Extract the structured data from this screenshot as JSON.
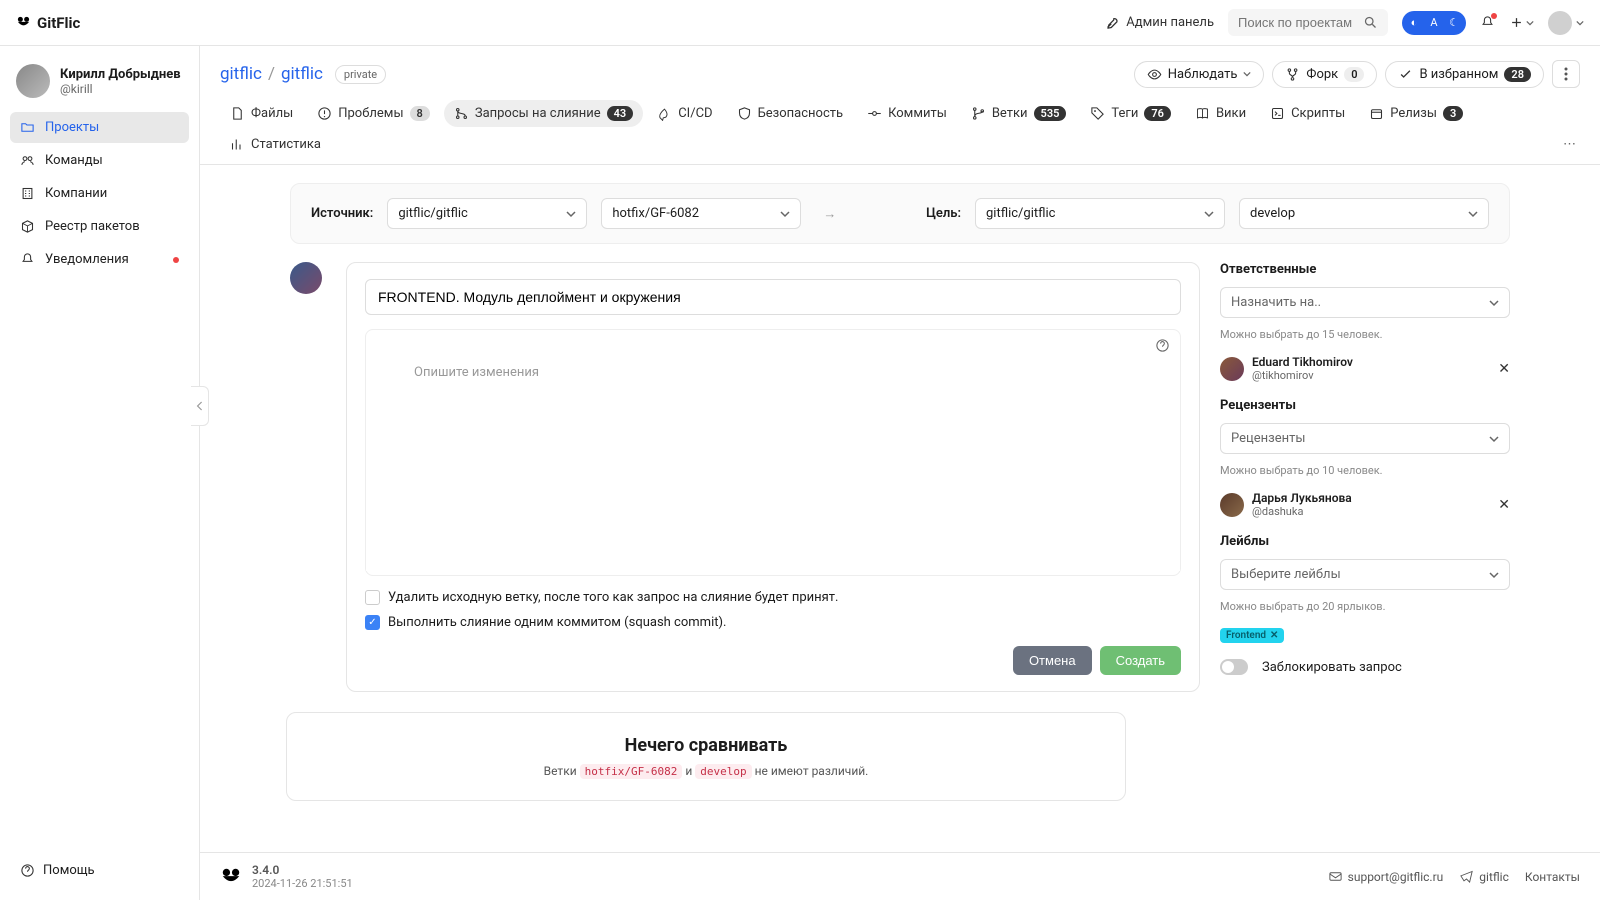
{
  "brand": "GitFlic",
  "topbar": {
    "admin": "Админ панель",
    "search_placeholder": "Поиск по проектам"
  },
  "user": {
    "name": "Кирилл Добрыднев",
    "handle": "@kirill"
  },
  "sidebar": {
    "items": [
      {
        "label": "Проекты"
      },
      {
        "label": "Команды"
      },
      {
        "label": "Компании"
      },
      {
        "label": "Реестр пакетов"
      },
      {
        "label": "Уведомления"
      }
    ],
    "help": "Помощь"
  },
  "repo": {
    "owner": "gitflic",
    "name": "gitflic",
    "visibility": "private",
    "actions": {
      "watch": "Наблюдать",
      "fork": "Форк",
      "fork_count": "0",
      "star": "В избранном",
      "star_count": "28"
    }
  },
  "tabs": [
    {
      "label": "Файлы"
    },
    {
      "label": "Проблемы",
      "count": "8"
    },
    {
      "label": "Запросы на слияние",
      "count": "43"
    },
    {
      "label": "CI/CD"
    },
    {
      "label": "Безопасность"
    },
    {
      "label": "Коммиты"
    },
    {
      "label": "Ветки",
      "count": "535"
    },
    {
      "label": "Теги",
      "count": "76"
    },
    {
      "label": "Вики"
    },
    {
      "label": "Скрипты"
    },
    {
      "label": "Релизы",
      "count": "3"
    },
    {
      "label": "Статистика"
    }
  ],
  "compare": {
    "source_label": "Источник:",
    "source_repo": "gitflic/gitflic",
    "source_branch": "hotfix/GF-6082",
    "target_label": "Цель:",
    "target_repo": "gitflic/gitflic",
    "target_branch": "develop"
  },
  "mr": {
    "title": "FRONTEND. Модуль деплоймент и окружения",
    "desc_placeholder": "Опишите изменения",
    "check_delete": "Удалить исходную ветку, после того как запрос на слияние будет принят.",
    "check_squash": "Выполнить слияние одним коммитом (squash commit).",
    "cancel": "Отмена",
    "create": "Создать"
  },
  "side": {
    "assignees_title": "Ответственные",
    "assignees_placeholder": "Назначить на..",
    "assignees_hint": "Можно выбрать до 15 человек.",
    "assignee": {
      "name": "Eduard Tikhomirov",
      "handle": "@tikhomirov"
    },
    "reviewers_title": "Рецензенты",
    "reviewers_placeholder": "Рецензенты",
    "reviewers_hint": "Можно выбрать до 10 человек.",
    "reviewer": {
      "name": "Дарья Лукьянова",
      "handle": "@dashuka"
    },
    "labels_title": "Лейблы",
    "labels_placeholder": "Выберите лейблы",
    "labels_hint": "Можно выбрать до 20 ярлыков.",
    "label_chip": "Frontend",
    "block": "Заблокировать запрос"
  },
  "empty": {
    "title": "Нечего сравнивать",
    "prefix": "Ветки",
    "b1": "hotfix/GF-6082",
    "and": "и",
    "b2": "develop",
    "suffix": "не имеют различий."
  },
  "footer": {
    "version": "3.4.0",
    "timestamp": "2024-11-26 21:51:51",
    "support": "support@gitflic.ru",
    "telegram": "gitflic",
    "contacts": "Контакты"
  }
}
